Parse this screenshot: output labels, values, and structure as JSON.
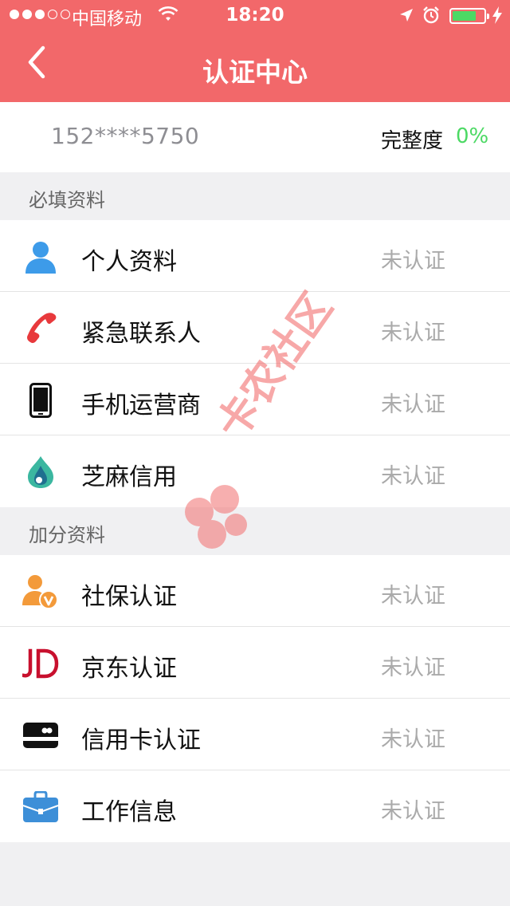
{
  "status_bar": {
    "carrier": "中国移动",
    "time": "18:20",
    "battery_level": 0.75
  },
  "header": {
    "title": "认证中心"
  },
  "account": {
    "phone": "152****5750",
    "completeness_label": "完整度",
    "completeness_value": "0%"
  },
  "sections": [
    {
      "title": "必填资料",
      "items": [
        {
          "label": "个人资料",
          "status": "未认证",
          "icon": "person-icon"
        },
        {
          "label": "紧急联系人",
          "status": "未认证",
          "icon": "phone-icon"
        },
        {
          "label": "手机运营商",
          "status": "未认证",
          "icon": "mobile-icon"
        },
        {
          "label": "芝麻信用",
          "status": "未认证",
          "icon": "sesame-credit-icon"
        }
      ]
    },
    {
      "title": "加分资料",
      "items": [
        {
          "label": "社保认证",
          "status": "未认证",
          "icon": "social-security-icon"
        },
        {
          "label": "京东认证",
          "status": "未认证",
          "icon": "jd-logo-icon"
        },
        {
          "label": "信用卡认证",
          "status": "未认证",
          "icon": "credit-card-icon"
        },
        {
          "label": "工作信息",
          "status": "未认证",
          "icon": "briefcase-icon"
        }
      ]
    }
  ],
  "watermark": {
    "text": "卡农社区"
  },
  "colors": {
    "header": "#f2686a",
    "completeness": "#4cd964",
    "status_text": "#aaaaaa"
  }
}
